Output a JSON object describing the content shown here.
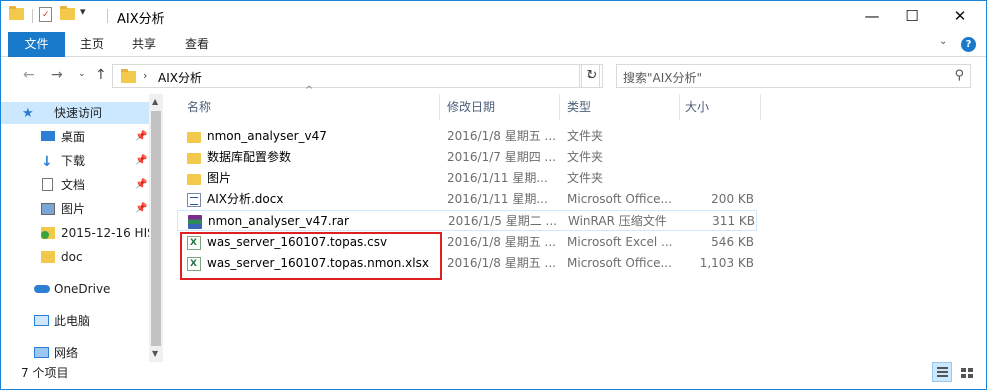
{
  "window": {
    "title": "AIX分析",
    "controls": {
      "minimize": "—",
      "maximize": "☐",
      "close": "✕"
    }
  },
  "ribbon": {
    "tabs": [
      {
        "label": "文件",
        "active": true
      },
      {
        "label": "主页"
      },
      {
        "label": "共享"
      },
      {
        "label": "查看"
      }
    ],
    "help": "?",
    "accent_color": "#1979ca"
  },
  "address": {
    "crumb": "AIX分析",
    "separator": "›",
    "search_placeholder": "搜索\"AIX分析\""
  },
  "nav": {
    "quick_access": "快速访问",
    "items": [
      {
        "label": "桌面",
        "icon": "desktop-icon",
        "pinned": true
      },
      {
        "label": "下载",
        "icon": "download-icon",
        "pinned": true
      },
      {
        "label": "文档",
        "icon": "document-icon",
        "pinned": true
      },
      {
        "label": "图片",
        "icon": "pictures-icon",
        "pinned": true
      },
      {
        "label": "2015-12-16 HIS",
        "icon": "folder-sync-icon",
        "pinned": false
      },
      {
        "label": "doc",
        "icon": "folder-icon",
        "pinned": false
      }
    ],
    "onedrive": "OneDrive",
    "this_pc": "此电脑",
    "network": "网络"
  },
  "columns": {
    "name": "名称",
    "date": "修改日期",
    "type": "类型",
    "size": "大小"
  },
  "files": [
    {
      "name": "nmon_analyser_v47",
      "date": "2016/1/8 星期五 ...",
      "type": "文件夹",
      "size": "",
      "icon": "folder"
    },
    {
      "name": "数据库配置参数",
      "date": "2016/1/7 星期四 ...",
      "type": "文件夹",
      "size": "",
      "icon": "folder"
    },
    {
      "name": "图片",
      "date": "2016/1/11 星期...",
      "type": "文件夹",
      "size": "",
      "icon": "folder"
    },
    {
      "name": "AIX分析.docx",
      "date": "2016/1/11 星期...",
      "type": "Microsoft Office...",
      "size": "200 KB",
      "icon": "docx"
    },
    {
      "name": "nmon_analyser_v47.rar",
      "date": "2016/1/5 星期二 ...",
      "type": "WinRAR 压缩文件",
      "size": "311 KB",
      "icon": "rar"
    },
    {
      "name": "was_server_160107.topas.csv",
      "date": "2016/1/8 星期五 ...",
      "type": "Microsoft Excel ...",
      "size": "546 KB",
      "icon": "xls"
    },
    {
      "name": "was_server_160107.topas.nmon.xlsx",
      "date": "2016/1/8 星期五 ...",
      "type": "Microsoft Office...",
      "size": "1,103 KB",
      "icon": "xls"
    }
  ],
  "status": {
    "count_text": "7 个项目"
  },
  "highlight_color": "#e02020"
}
